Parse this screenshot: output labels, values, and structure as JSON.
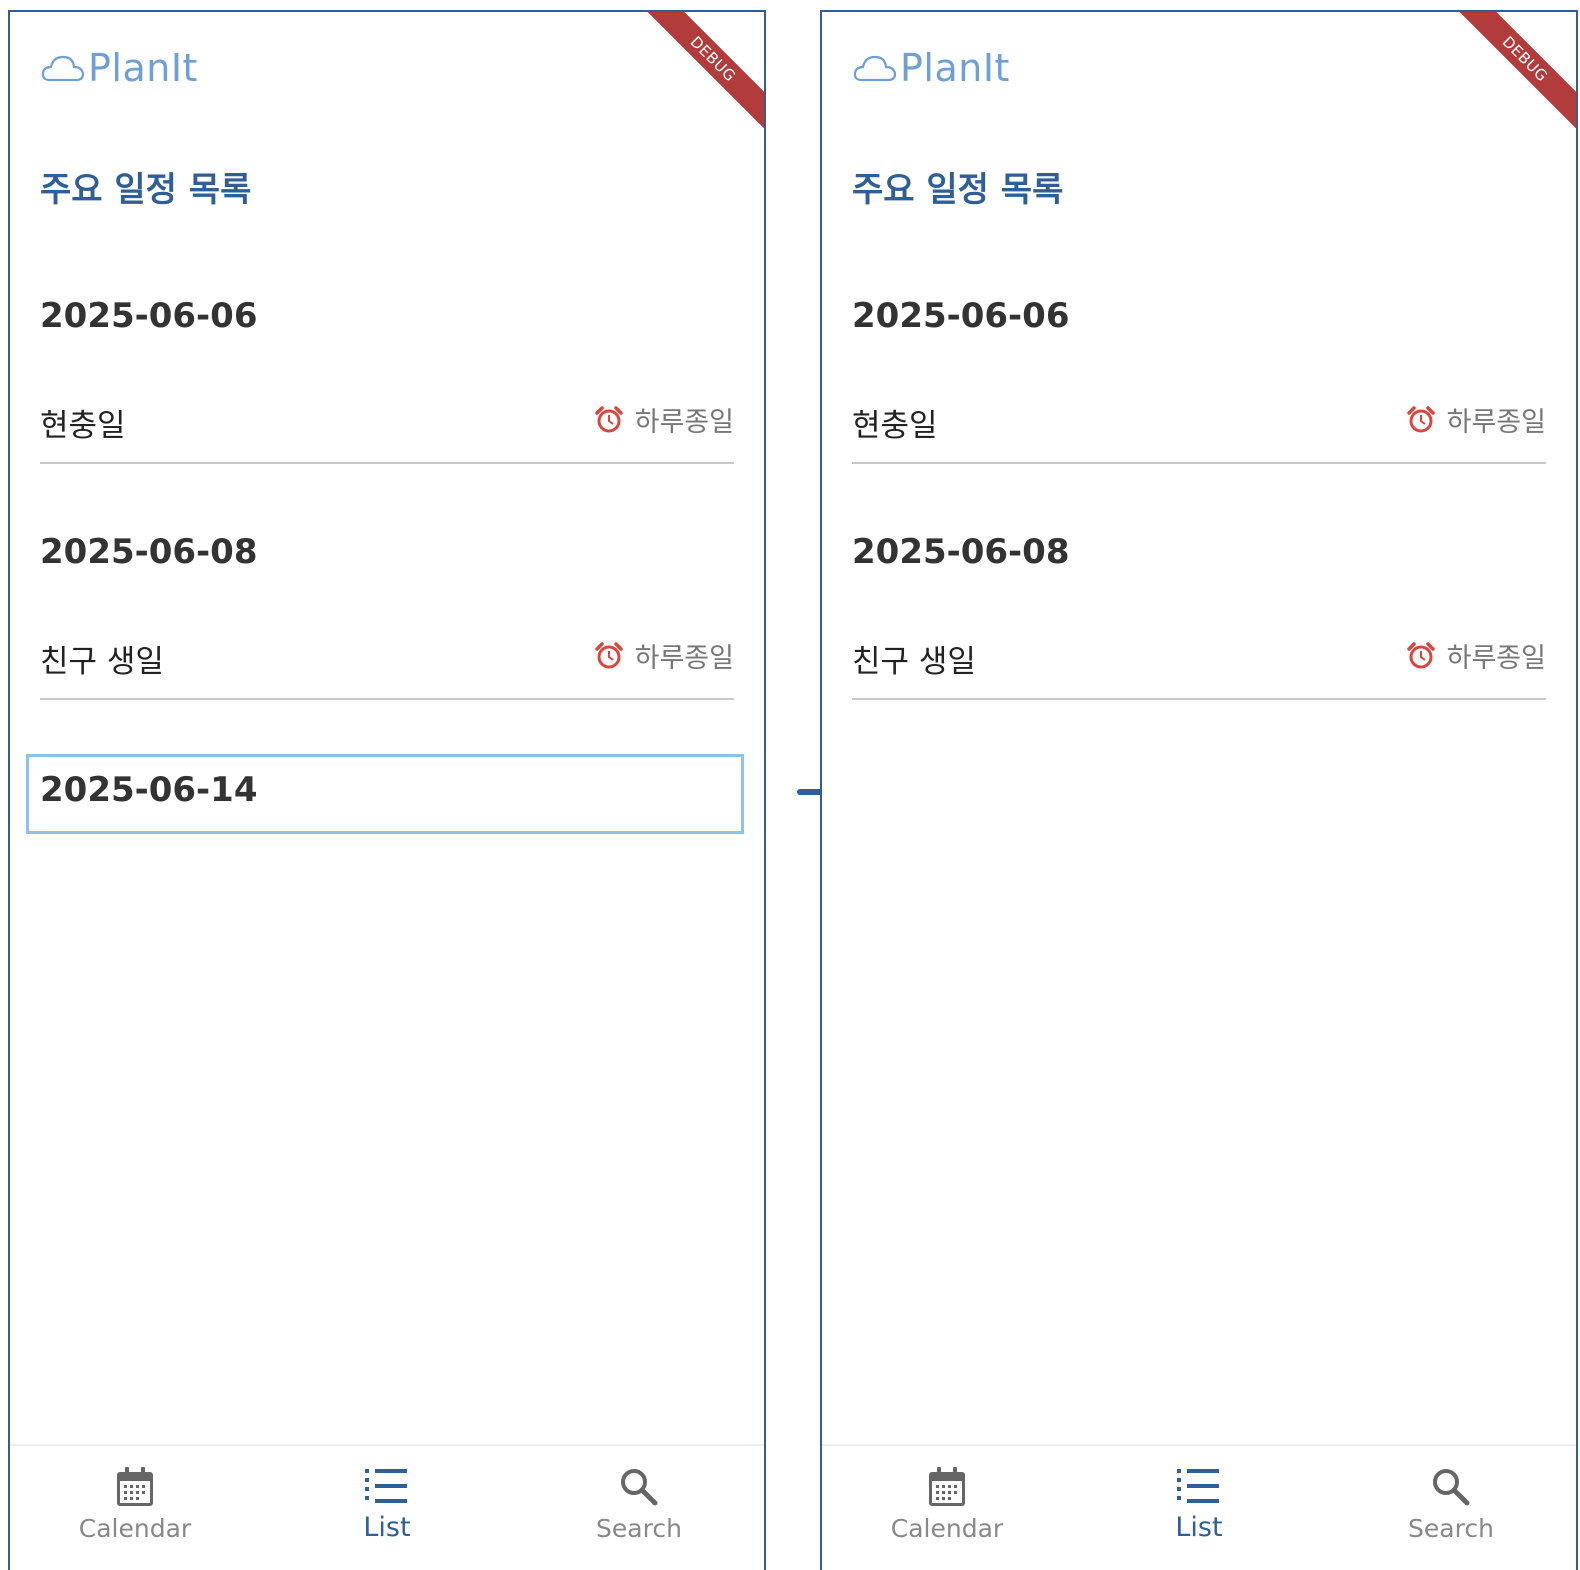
{
  "colors": {
    "primary": "#2f5f96",
    "logo": "#6f9fd6",
    "alarm": "#d9463e",
    "highlight": "#8cc2f0",
    "debug_banner": "#b23b3b"
  },
  "app": {
    "name": "PlanIt",
    "logo_icon": "cloud-icon",
    "debug_label": "DEBUG"
  },
  "page": {
    "title": "주요 일정 목록"
  },
  "screens": {
    "before": {
      "groups": [
        {
          "date": "2025-06-06",
          "events": [
            {
              "name": "현충일",
              "time": "하루종일",
              "icon": "alarm-clock-icon"
            }
          ]
        },
        {
          "date": "2025-06-08",
          "events": [
            {
              "name": "친구 생일",
              "time": "하루종일",
              "icon": "alarm-clock-icon"
            }
          ]
        },
        {
          "date": "2025-06-14",
          "events": [],
          "highlighted": true
        }
      ]
    },
    "after": {
      "groups": [
        {
          "date": "2025-06-06",
          "events": [
            {
              "name": "현충일",
              "time": "하루종일",
              "icon": "alarm-clock-icon"
            }
          ]
        },
        {
          "date": "2025-06-08",
          "events": [
            {
              "name": "친구 생일",
              "time": "하루종일",
              "icon": "alarm-clock-icon"
            }
          ]
        }
      ]
    }
  },
  "nav": {
    "items": [
      {
        "label": "Calendar",
        "icon": "calendar-icon",
        "active": false
      },
      {
        "label": "List",
        "icon": "list-icon",
        "active": true
      },
      {
        "label": "Search",
        "icon": "search-icon",
        "active": false
      }
    ]
  },
  "transition_icon": "arrow-right-icon"
}
